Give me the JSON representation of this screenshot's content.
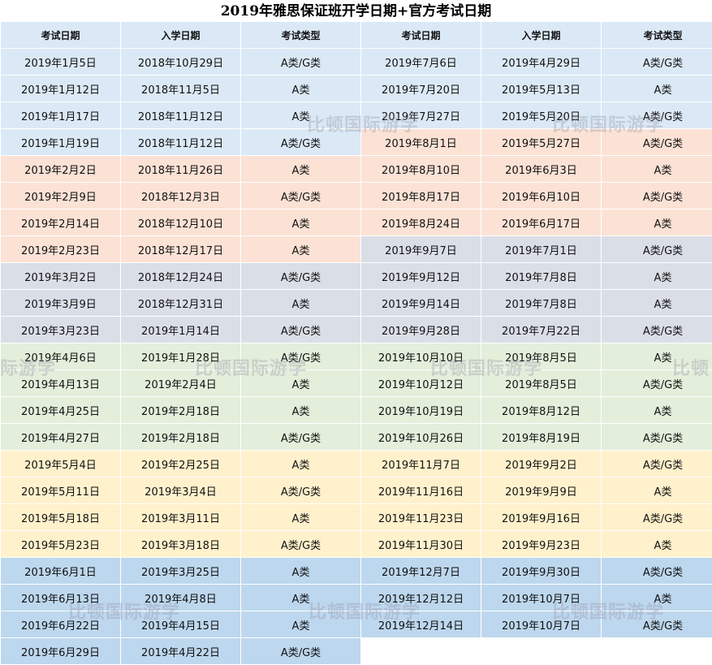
{
  "title": "2019年雅思保证班开学日期+官方考试日期",
  "headers": [
    "考试日期",
    "入学日期",
    "考试类型",
    "考试日期",
    "入学日期",
    "考试类型"
  ],
  "watermark": "比顿国际游学",
  "watermark_partial_left": "际游学",
  "watermark_partial_right": "比顿",
  "colors": {
    "blue": "#dbe9f6",
    "salmon": "#fbe2d5",
    "grey": "#dadee7",
    "green": "#e3eedb",
    "yellow": "#fff1cc",
    "dblue": "#bdd7ee"
  },
  "rows": [
    {
      "l": [
        "2019年1月5日",
        "2018年10月29日",
        "A类/G类"
      ],
      "lc": "blue",
      "r": [
        "2019年7月6日",
        "2019年4月29日",
        "A类/G类"
      ],
      "rc": "blue"
    },
    {
      "l": [
        "2019年1月12日",
        "2018年11月5日",
        "A类"
      ],
      "lc": "blue",
      "r": [
        "2019年7月20日",
        "2019年5月13日",
        "A类"
      ],
      "rc": "blue"
    },
    {
      "l": [
        "2019年1月17日",
        "2018年11月12日",
        "A类"
      ],
      "lc": "blue",
      "r": [
        "2019年7月27日",
        "2019年5月20日",
        "A类/G类"
      ],
      "rc": "blue"
    },
    {
      "l": [
        "2019年1月19日",
        "2018年11月12日",
        "A类/G类"
      ],
      "lc": "blue",
      "r": [
        "2019年8月1日",
        "2019年5月27日",
        "A类/G类"
      ],
      "rc": "salmon"
    },
    {
      "l": [
        "2019年2月2日",
        "2018年11月26日",
        "A类"
      ],
      "lc": "salmon",
      "r": [
        "2019年8月10日",
        "2019年6月3日",
        "A类"
      ],
      "rc": "salmon"
    },
    {
      "l": [
        "2019年2月9日",
        "2018年12月3日",
        "A类/G类"
      ],
      "lc": "salmon",
      "r": [
        "2019年8月17日",
        "2019年6月10日",
        "A类/G类"
      ],
      "rc": "salmon"
    },
    {
      "l": [
        "2019年2月14日",
        "2018年12月10日",
        "A类"
      ],
      "lc": "salmon",
      "r": [
        "2019年8月24日",
        "2019年6月17日",
        "A类"
      ],
      "rc": "salmon"
    },
    {
      "l": [
        "2019年2月23日",
        "2018年12月17日",
        "A类"
      ],
      "lc": "salmon",
      "r": [
        "2019年9月7日",
        "2019年7月1日",
        "A类/G类"
      ],
      "rc": "grey"
    },
    {
      "l": [
        "2019年3月2日",
        "2018年12月24日",
        "A类/G类"
      ],
      "lc": "grey",
      "r": [
        "2019年9月12日",
        "2019年7月8日",
        "A类"
      ],
      "rc": "grey"
    },
    {
      "l": [
        "2019年3月9日",
        "2018年12月31日",
        "A类"
      ],
      "lc": "grey",
      "r": [
        "2019年9月14日",
        "2019年7月8日",
        "A类"
      ],
      "rc": "grey"
    },
    {
      "l": [
        "2019年3月23日",
        "2019年1月14日",
        "A类/G类"
      ],
      "lc": "grey",
      "r": [
        "2019年9月28日",
        "2019年7月22日",
        "A类/G类"
      ],
      "rc": "grey"
    },
    {
      "l": [
        "2019年4月6日",
        "2019年1月28日",
        "A类/G类"
      ],
      "lc": "green",
      "r": [
        "2019年10月10日",
        "2019年8月5日",
        "A类"
      ],
      "rc": "green"
    },
    {
      "l": [
        "2019年4月13日",
        "2019年2月4日",
        "A类"
      ],
      "lc": "green",
      "r": [
        "2019年10月12日",
        "2019年8月5日",
        "A类/G类"
      ],
      "rc": "green"
    },
    {
      "l": [
        "2019年4月25日",
        "2019年2月18日",
        "A类"
      ],
      "lc": "green",
      "r": [
        "2019年10月19日",
        "2019年8月12日",
        "A类"
      ],
      "rc": "green"
    },
    {
      "l": [
        "2019年4月27日",
        "2019年2月18日",
        "A类/G类"
      ],
      "lc": "green",
      "r": [
        "2019年10月26日",
        "2019年8月19日",
        "A类/G类"
      ],
      "rc": "green"
    },
    {
      "l": [
        "2019年5月4日",
        "2019年2月25日",
        "A类"
      ],
      "lc": "yellow",
      "r": [
        "2019年11月7日",
        "2019年9月2日",
        "A类/G类"
      ],
      "rc": "yellow"
    },
    {
      "l": [
        "2019年5月11日",
        "2019年3月4日",
        "A类/G类"
      ],
      "lc": "yellow",
      "r": [
        "2019年11月16日",
        "2019年9月9日",
        "A类"
      ],
      "rc": "yellow"
    },
    {
      "l": [
        "2019年5月18日",
        "2019年3月11日",
        "A类"
      ],
      "lc": "yellow",
      "r": [
        "2019年11月23日",
        "2019年9月16日",
        "A类/G类"
      ],
      "rc": "yellow"
    },
    {
      "l": [
        "2019年5月23日",
        "2019年3月18日",
        "A类/G类"
      ],
      "lc": "yellow",
      "r": [
        "2019年11月30日",
        "2019年9月23日",
        "A类"
      ],
      "rc": "yellow"
    },
    {
      "l": [
        "2019年6月1日",
        "2019年3月25日",
        "A类"
      ],
      "lc": "dblue",
      "r": [
        "2019年12月7日",
        "2019年9月30日",
        "A类/G类"
      ],
      "rc": "dblue"
    },
    {
      "l": [
        "2019年6月13日",
        "2019年4月8日",
        "A类"
      ],
      "lc": "dblue",
      "r": [
        "2019年12月12日",
        "2019年10月7日",
        "A类"
      ],
      "rc": "dblue"
    },
    {
      "l": [
        "2019年6月22日",
        "2019年4月15日",
        "A类"
      ],
      "lc": "dblue",
      "r": [
        "2019年12月14日",
        "2019年10月7日",
        "A类/G类"
      ],
      "rc": "dblue"
    },
    {
      "l": [
        "2019年6月29日",
        "2019年4月22日",
        "A类/G类"
      ],
      "lc": "dblue",
      "r": [
        "",
        "",
        ""
      ],
      "rc": "empty"
    }
  ]
}
